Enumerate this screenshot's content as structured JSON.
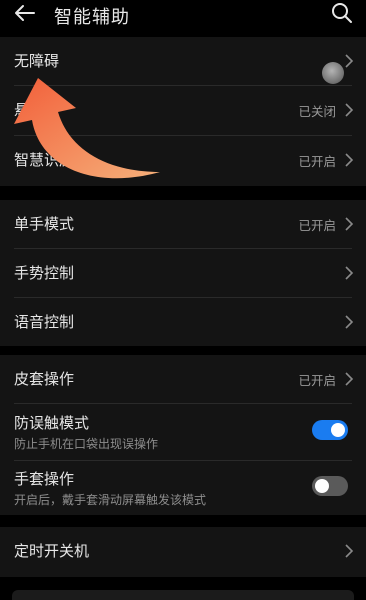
{
  "header": {
    "title": "智能辅助",
    "back_icon": "arrow-left-icon",
    "search_icon": "search-icon"
  },
  "groups": [
    {
      "items": [
        {
          "label": "无障碍",
          "status": ""
        },
        {
          "label": "悬",
          "status": "已关闭"
        },
        {
          "label": "智慧识屏",
          "status": "已开启"
        }
      ]
    },
    {
      "items": [
        {
          "label": "单手模式",
          "status": "已开启"
        },
        {
          "label": "手势控制",
          "status": ""
        },
        {
          "label": "语音控制",
          "status": ""
        }
      ]
    },
    {
      "items": [
        {
          "label": "皮套操作",
          "status": "已开启"
        },
        {
          "label": "防误触模式",
          "subtitle": "防止手机在口袋出现误操作",
          "toggle": true
        },
        {
          "label": "手套操作",
          "subtitle": "开启后，戴手套滑动屏幕触发该模式",
          "toggle": false
        }
      ]
    },
    {
      "items": [
        {
          "label": "定时开关机",
          "status": ""
        }
      ]
    }
  ],
  "colors": {
    "background": "#000000",
    "card": "#141414",
    "toggle_on": "#1a7cf0",
    "toggle_off": "#5a5a5a",
    "annotation_arrow": "#f07a4a"
  }
}
